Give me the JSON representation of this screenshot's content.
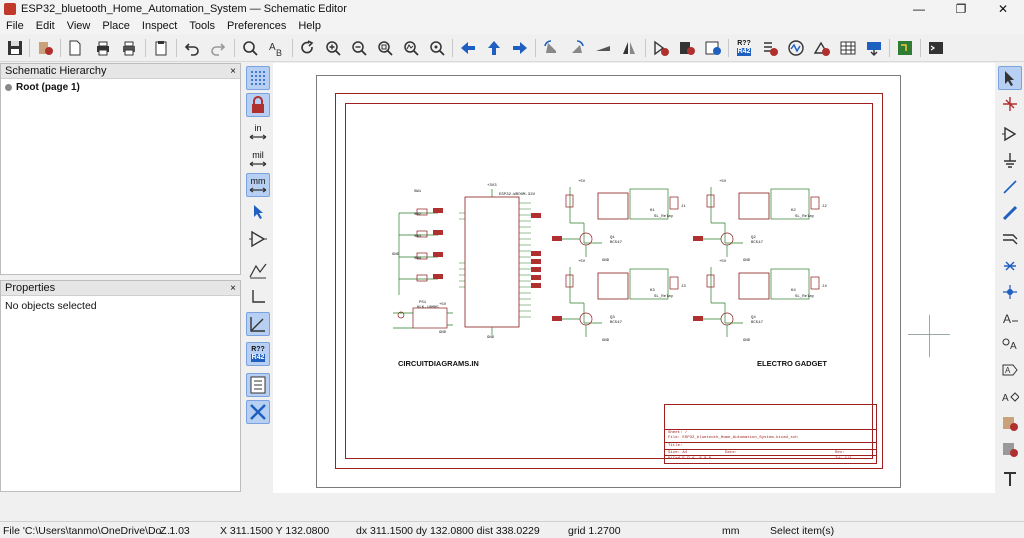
{
  "window": {
    "title": "ESP32_bluetooth_Home_Automation_System — Schematic Editor",
    "minimize": "—",
    "maximize": "❐",
    "close": "✕"
  },
  "menu": [
    "File",
    "Edit",
    "View",
    "Place",
    "Inspect",
    "Tools",
    "Preferences",
    "Help"
  ],
  "panels": {
    "hierarchy": {
      "title": "Schematic Hierarchy",
      "close": "×",
      "root": "Root (page 1)"
    },
    "properties": {
      "title": "Properties",
      "close": "×",
      "empty": "No objects selected"
    }
  },
  "left_tools": {
    "units_in": "in",
    "units_mil": "mil",
    "units_mm": "mm",
    "annotate_top": "R??",
    "annotate_bottom": "R42"
  },
  "toolbar_badges": {
    "annotate_top": "R??",
    "annotate_bottom": "R42"
  },
  "schematic": {
    "left_label": "CIRCUITDIAGRAMS.IN",
    "right_label": "ELECTRO GADGET",
    "title_block": {
      "sheet": "Sheet: /",
      "file": "File: ESP32_bluetooth_Home_Automation_System.kicad_sch",
      "title": "Title:",
      "size_label": "Size: A4",
      "date_label": "Date:",
      "rev_label": "Rev:",
      "kicad": "KiCad E.D.A. 8.0.0",
      "id": "Id: 1/1"
    },
    "components": {
      "sw1": "SW1",
      "sw2": "SW2",
      "sw3": "SW3",
      "sw4": "SW4",
      "esp": "ESP32-WROOM-32U",
      "q1": "Q1",
      "q2": "Q2",
      "q3": "Q3",
      "q4": "Q4",
      "k1": "K1",
      "k2": "K2",
      "k3": "K3",
      "k4": "K4",
      "j1": "J1",
      "j2": "J2",
      "j3": "J3",
      "j4": "J4",
      "ps1": "PS1",
      "gnd": "GND",
      "plus5v": "+5V",
      "plus3v3": "+3V3",
      "q_part": "BC547",
      "relay_part": "SL_Relay",
      "ps_part": "HLK-10M05"
    },
    "title_color": "#a02020"
  },
  "status": {
    "file": "File 'C:\\Users\\tanmo\\OneDrive\\Do...",
    "zoom": "Z 1.03",
    "coords": "X 311.1500  Y 132.0800",
    "delta": "dx 311.1500  dy 132.0800  dist 338.0229",
    "grid": "grid 1.2700",
    "units": "mm",
    "mode": "Select item(s)"
  },
  "colors": {
    "frame": "#a02020",
    "wire": "#2a7d2a",
    "component": "#8b1a1a",
    "accent_blue": "#1e5fbf",
    "active_bg": "#b7cff2"
  }
}
